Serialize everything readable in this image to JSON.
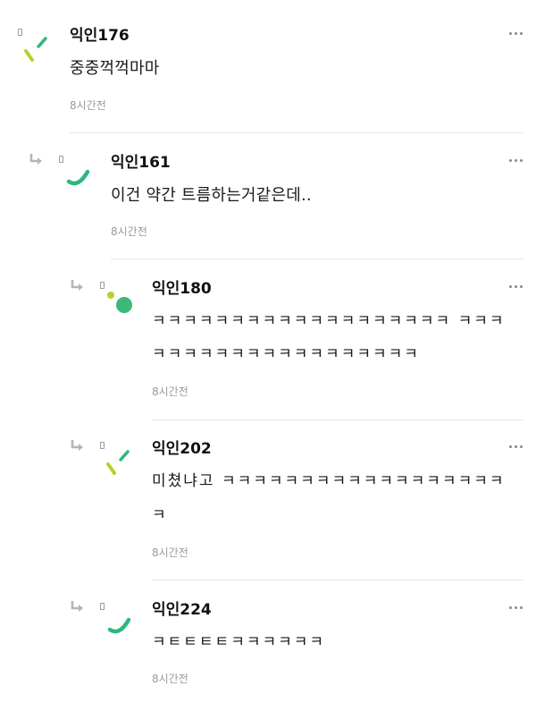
{
  "comments": [
    {
      "author": "익인176",
      "lines": [
        "중중꺽꺽마마"
      ],
      "time": "8시간전",
      "avatar_icon": "lime-dash-avatar-icon"
    },
    {
      "author": "익인161",
      "lines": [
        "이건 약간 트름하는거같은데.."
      ],
      "time": "8시간전",
      "avatar_icon": "green-arc-avatar-icon"
    },
    {
      "author": "익인180",
      "lines": [
        "ㅋㅋㅋㅋㅋㅋㅋㅋㅋㅋㅋㅋㅋㅋㅋㅋㅋㅋㅋ ㅋㅋㅋ",
        "ㅋㅋㅋㅋㅋㅋㅋㅋㅋㅋㅋㅋㅋㅋㅋㅋㅋ"
      ],
      "time": "8시간전",
      "avatar_icon": "green-dots-avatar-icon"
    },
    {
      "author": "익인202",
      "lines": [
        "미쳤냐고 ㅋㅋㅋㅋㅋㅋㅋㅋㅋㅋㅋㅋㅋㅋㅋㅋㅋㅋ",
        "ㅋ"
      ],
      "time": "8시간전",
      "avatar_icon": "lime-dash-avatar-icon"
    },
    {
      "author": "익인224",
      "lines": [
        "ㅋㅌㅌㅌㅌㅋㅋㅋㅋㅋㅋ"
      ],
      "time": "8시간전",
      "avatar_icon": "green-arc-avatar-icon"
    }
  ],
  "colors": {
    "accent_green": "#2db77b",
    "accent_lime": "#b7d12c",
    "time_gray": "#9a9a9a",
    "divider": "#e6e6e6"
  }
}
